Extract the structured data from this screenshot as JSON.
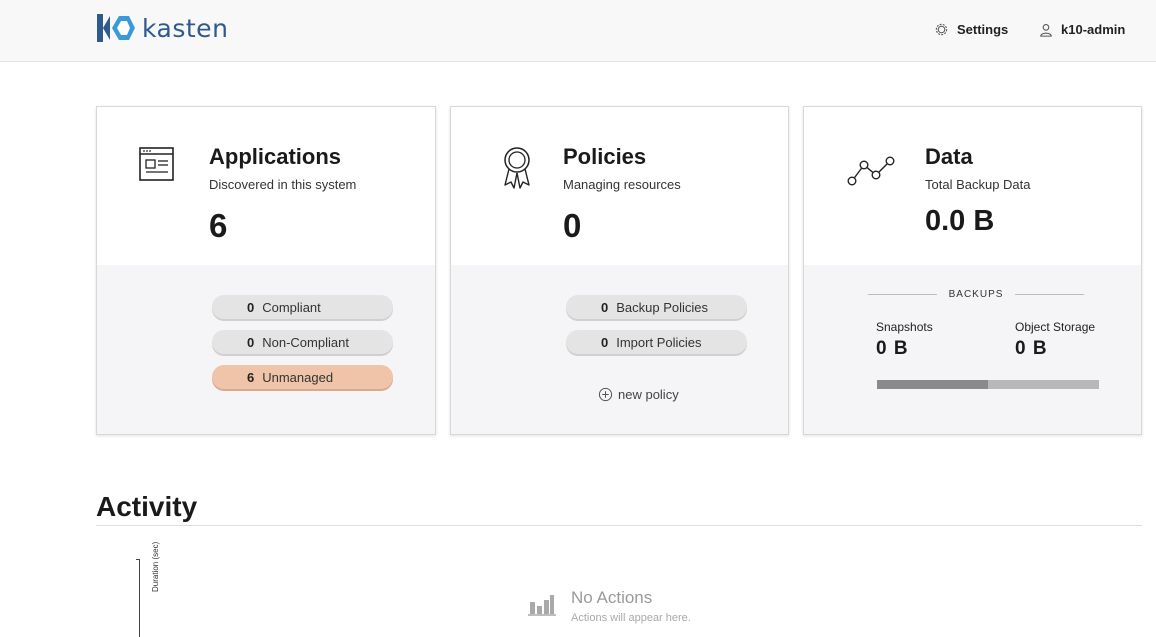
{
  "header": {
    "brand": "kasten",
    "brand_color": "#2e5a8c",
    "accent_color": "#3a9ad9",
    "settings_label": "Settings",
    "settings_icon": "gear-icon",
    "user_label": "k10-admin",
    "user_icon": "user-icon"
  },
  "cards": {
    "applications": {
      "icon": "application-window-icon",
      "title": "Applications",
      "subtitle": "Discovered in this system",
      "count": "6",
      "pills": [
        {
          "count": "0",
          "label": "Compliant"
        },
        {
          "count": "0",
          "label": "Non-Compliant"
        },
        {
          "count": "6",
          "label": "Unmanaged",
          "color": "#f0c4a8"
        }
      ]
    },
    "policies": {
      "icon": "award-ribbon-icon",
      "title": "Policies",
      "subtitle": "Managing resources",
      "count": "0",
      "pills": [
        {
          "count": "0",
          "label": "Backup Policies"
        },
        {
          "count": "0",
          "label": "Import Policies"
        }
      ],
      "new_policy_label": "new policy"
    },
    "data": {
      "icon": "line-graph-icon",
      "title": "Data",
      "subtitle": "Total Backup Data",
      "total": "0.0 B",
      "backups_heading": "BACKUPS",
      "snapshots_label": "Snapshots",
      "snapshots_value": "0 B",
      "object_storage_label": "Object Storage",
      "object_storage_value": "0 B",
      "snapshot_share": 0.5
    }
  },
  "activity": {
    "title": "Activity",
    "axis_label": "Duration (sec)",
    "empty_title": "No Actions",
    "empty_subtitle": "Actions will appear here.",
    "empty_icon": "bar-chart-icon"
  }
}
